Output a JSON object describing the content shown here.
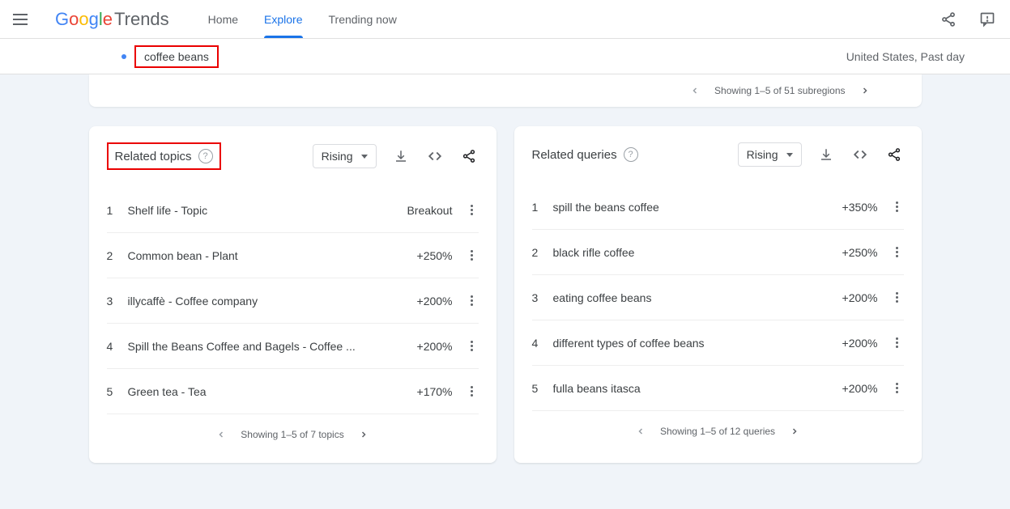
{
  "header": {
    "logo_trends": "Trends",
    "nav": {
      "home": "Home",
      "explore": "Explore",
      "trending": "Trending now"
    }
  },
  "subheader": {
    "term": "coffee beans",
    "locale": "United States, Past day"
  },
  "subregions": {
    "showing": "Showing 1–5 of 51 subregions"
  },
  "topics": {
    "title": "Related topics",
    "dropdown": "Rising",
    "items": {
      "0": {
        "rank": "1",
        "label": "Shelf life - Topic",
        "metric": "Breakout"
      },
      "1": {
        "rank": "2",
        "label": "Common bean - Plant",
        "metric": "+250%"
      },
      "2": {
        "rank": "3",
        "label": "illycaffè - Coffee company",
        "metric": "+200%"
      },
      "3": {
        "rank": "4",
        "label": "Spill the Beans Coffee and Bagels - Coffee ...",
        "metric": "+200%"
      },
      "4": {
        "rank": "5",
        "label": "Green tea - Tea",
        "metric": "+170%"
      }
    },
    "footer": "Showing 1–5 of 7 topics"
  },
  "queries": {
    "title": "Related queries",
    "dropdown": "Rising",
    "items": {
      "0": {
        "rank": "1",
        "label": "spill the beans coffee",
        "metric": "+350%"
      },
      "1": {
        "rank": "2",
        "label": "black rifle coffee",
        "metric": "+250%"
      },
      "2": {
        "rank": "3",
        "label": "eating coffee beans",
        "metric": "+200%"
      },
      "3": {
        "rank": "4",
        "label": "different types of coffee beans",
        "metric": "+200%"
      },
      "4": {
        "rank": "5",
        "label": "fulla beans itasca",
        "metric": "+200%"
      }
    },
    "footer": "Showing 1–5 of 12 queries"
  }
}
